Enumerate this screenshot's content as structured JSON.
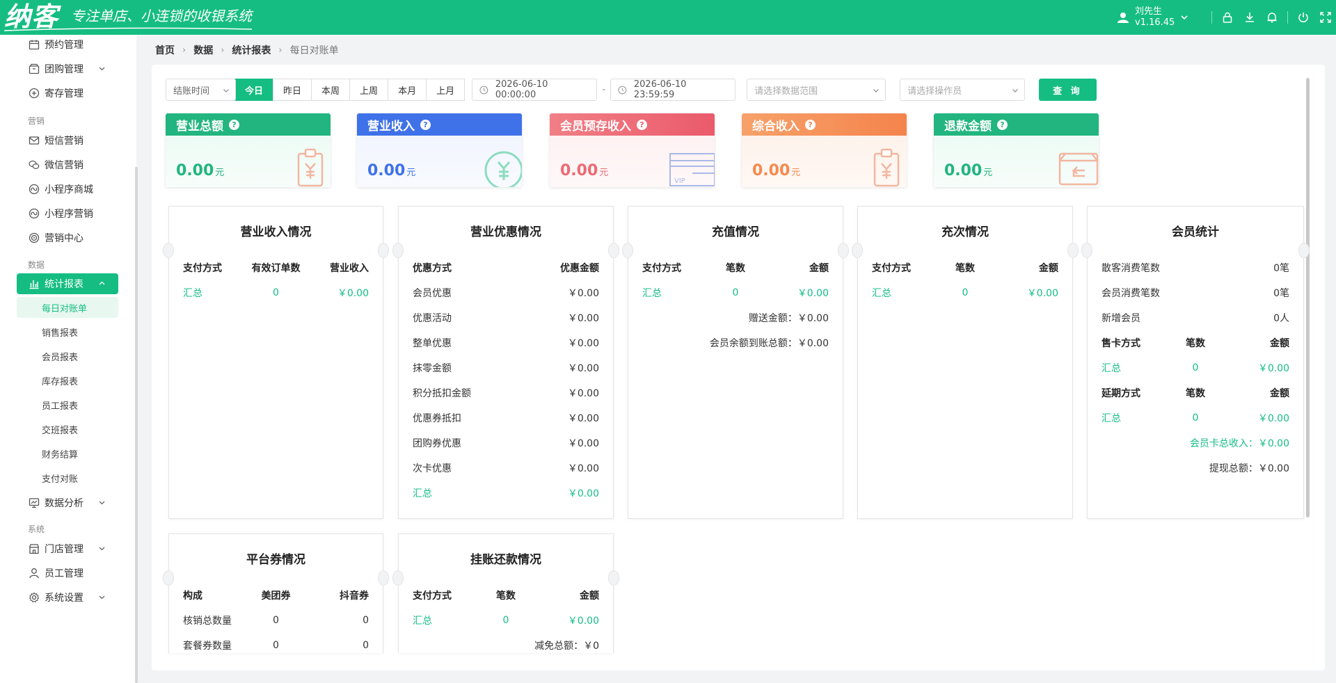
{
  "app": {
    "logo": "纳客",
    "slogan": "专注单店、小连锁的收银系统",
    "user_name": "刘先生",
    "version": "v1.16.45"
  },
  "sidebar": {
    "items_top": [
      {
        "label": "预约管理",
        "icon": "calendar-icon"
      },
      {
        "label": "团购管理",
        "icon": "group-buy-icon",
        "expandable": true
      },
      {
        "label": "寄存管理",
        "icon": "storage-icon"
      }
    ],
    "group_marketing": "营销",
    "items_marketing": [
      {
        "label": "短信营销",
        "icon": "mail-icon"
      },
      {
        "label": "微信营销",
        "icon": "wechat-icon"
      },
      {
        "label": "小程序商城",
        "icon": "mini-program-icon"
      },
      {
        "label": "小程序营销",
        "icon": "mini-program-icon"
      },
      {
        "label": "营销中心",
        "icon": "target-icon"
      }
    ],
    "group_data": "数据",
    "active_item": "统计报表",
    "sub_items": [
      "每日对账单",
      "销售报表",
      "会员报表",
      "库存报表",
      "员工报表",
      "交班报表",
      "财务结算",
      "支付对账"
    ],
    "data_analysis": "数据分析",
    "group_system": "系统",
    "items_system": [
      {
        "label": "门店管理",
        "expandable": true
      },
      {
        "label": "员工管理",
        "expandable": false
      },
      {
        "label": "系统设置",
        "expandable": true
      }
    ]
  },
  "breadcrumb": [
    "首页",
    "数据",
    "统计报表",
    "每日对账单"
  ],
  "filters": {
    "time_type": "结账时间",
    "periods": [
      "今日",
      "昨日",
      "本周",
      "上周",
      "本月",
      "上月"
    ],
    "active_period": "今日",
    "start": "2026-06-10 00:00:00",
    "end": "2026-06-10 23:59:59",
    "range_placeholder": "请选择数据范围",
    "operator_placeholder": "请选择操作员",
    "query_label": "查 询"
  },
  "stats": [
    {
      "title": "营业总额",
      "value": "0.00",
      "unit": "元",
      "color": "#22b57f"
    },
    {
      "title": "营业收入",
      "value": "0.00",
      "unit": "元",
      "color": "#3f72e8"
    },
    {
      "title": "会员预存收入",
      "value": "0.00",
      "unit": "元",
      "color": "#ec6b73"
    },
    {
      "title": "综合收入",
      "value": "0.00",
      "unit": "元",
      "color": "#f58a4e"
    },
    {
      "title": "退款金额",
      "value": "0.00",
      "unit": "元",
      "color": "#22b57f"
    }
  ],
  "revenue": {
    "title": "营业收入情况",
    "headers": [
      "支付方式",
      "有效订单数",
      "营业收入"
    ],
    "total": [
      "汇总",
      "0",
      "￥0.00"
    ]
  },
  "discount": {
    "title": "营业优惠情况",
    "headers": [
      "优惠方式",
      "优惠金额"
    ],
    "rows": [
      [
        "会员优惠",
        "￥0.00"
      ],
      [
        "优惠活动",
        "￥0.00"
      ],
      [
        "整单优惠",
        "￥0.00"
      ],
      [
        "抹零金额",
        "￥0.00"
      ],
      [
        "积分抵扣金额",
        "￥0.00"
      ],
      [
        "优惠券抵扣",
        "￥0.00"
      ],
      [
        "团购券优惠",
        "￥0.00"
      ],
      [
        "次卡优惠",
        "￥0.00"
      ]
    ],
    "total": [
      "汇总",
      "￥0.00"
    ]
  },
  "recharge": {
    "title": "充值情况",
    "headers": [
      "支付方式",
      "笔数",
      "金额"
    ],
    "total": [
      "汇总",
      "0",
      "￥0.00"
    ],
    "gift_label": "赠送金额：",
    "gift_value": "￥0.00",
    "balance_label": "会员余额到账总额：",
    "balance_value": "￥0.00"
  },
  "count_card": {
    "title": "充次情况",
    "headers": [
      "支付方式",
      "笔数",
      "金额"
    ],
    "total": [
      "汇总",
      "0",
      "￥0.00"
    ]
  },
  "member": {
    "title": "会员统计",
    "rows": [
      [
        "散客消费笔数",
        "0笔"
      ],
      [
        "会员消费笔数",
        "0笔"
      ],
      [
        "新增会员",
        "0人"
      ]
    ],
    "sale_headers": [
      "售卡方式",
      "笔数",
      "金额"
    ],
    "sale_total": [
      "汇总",
      "0",
      "￥0.00"
    ],
    "ext_headers": [
      "延期方式",
      "笔数",
      "金额"
    ],
    "ext_total": [
      "汇总",
      "0",
      "￥0.00"
    ],
    "card_income_label": "会员卡总收入：",
    "card_income_value": "￥0.00",
    "withdraw_label": "提现总额：",
    "withdraw_value": "￥0.00"
  },
  "platform": {
    "title": "平台券情况",
    "headers": [
      "构成",
      "美团券",
      "抖音券"
    ],
    "rows": [
      [
        "核销总数量",
        "0",
        "0"
      ],
      [
        "套餐券数量",
        "0",
        "0"
      ]
    ]
  },
  "credit": {
    "title": "挂账还款情况",
    "headers": [
      "支付方式",
      "笔数",
      "金额"
    ],
    "total": [
      "汇总",
      "0",
      "￥0.00"
    ],
    "waive_label": "减免总额：",
    "waive_value": "￥0"
  }
}
